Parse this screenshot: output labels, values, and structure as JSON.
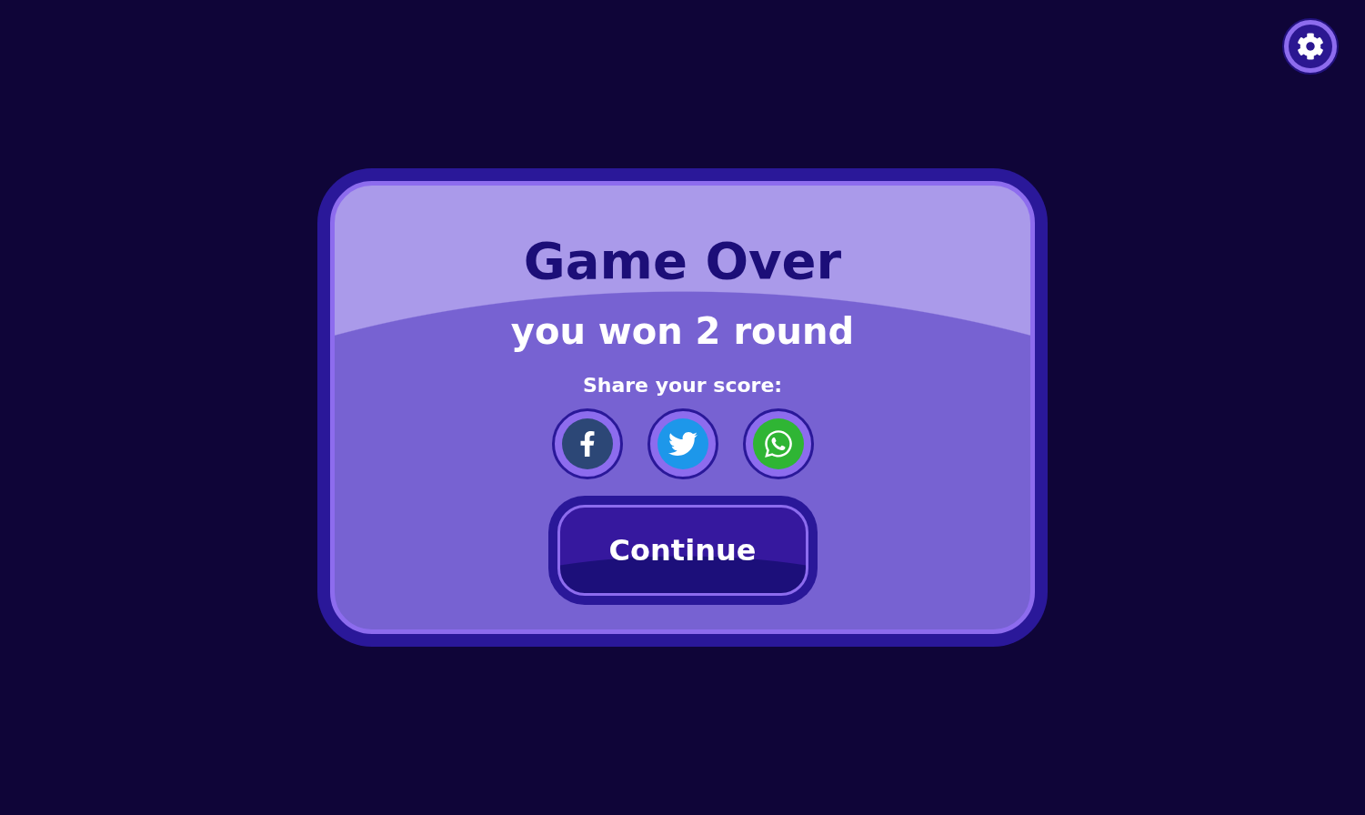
{
  "dialog": {
    "title": "Game Over",
    "message": "you won 2 round",
    "share": {
      "label": "Share your score:",
      "buttons": [
        {
          "kind": "facebook"
        },
        {
          "kind": "twitter"
        },
        {
          "kind": "whatsapp"
        }
      ]
    },
    "continue_button": {
      "label": "Continue"
    }
  }
}
